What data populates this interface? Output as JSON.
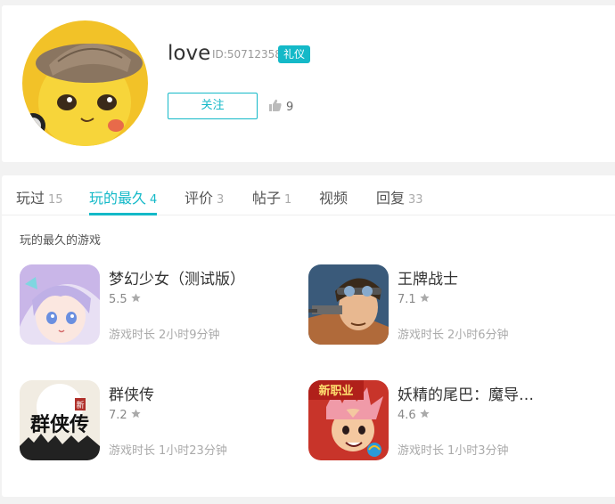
{
  "profile": {
    "username": "love",
    "user_id": "ID:50712358",
    "badge": "礼仪",
    "follow_label": "关注",
    "like_count": "9"
  },
  "tabs": [
    {
      "label": "玩过",
      "count": "15"
    },
    {
      "label": "玩的最久",
      "count": "4"
    },
    {
      "label": "评价",
      "count": "3"
    },
    {
      "label": "帖子",
      "count": "1"
    },
    {
      "label": "视频",
      "count": ""
    },
    {
      "label": "回复",
      "count": "33"
    }
  ],
  "active_tab": "玩的最久",
  "section_title": "玩的最久的游戏",
  "play_time_label": "游戏时长",
  "games": [
    {
      "name": "梦幻少女（测试版）",
      "score": "5.5",
      "play_time": "2小时9分钟"
    },
    {
      "name": "王牌战士",
      "score": "7.1",
      "play_time": "2小时6分钟"
    },
    {
      "name": "群侠传",
      "score": "7.2",
      "play_time": "1小时23分钟"
    },
    {
      "name": "妖精的尾巴：魔导…",
      "score": "4.6",
      "play_time": "1小时3分钟"
    }
  ],
  "game_icon_text": {
    "qunxia": "群侠传",
    "qunxia_small": "新",
    "yaojing": "新职业"
  },
  "colors": {
    "accent": "#14b9c8",
    "background": "#f2f2f2"
  }
}
